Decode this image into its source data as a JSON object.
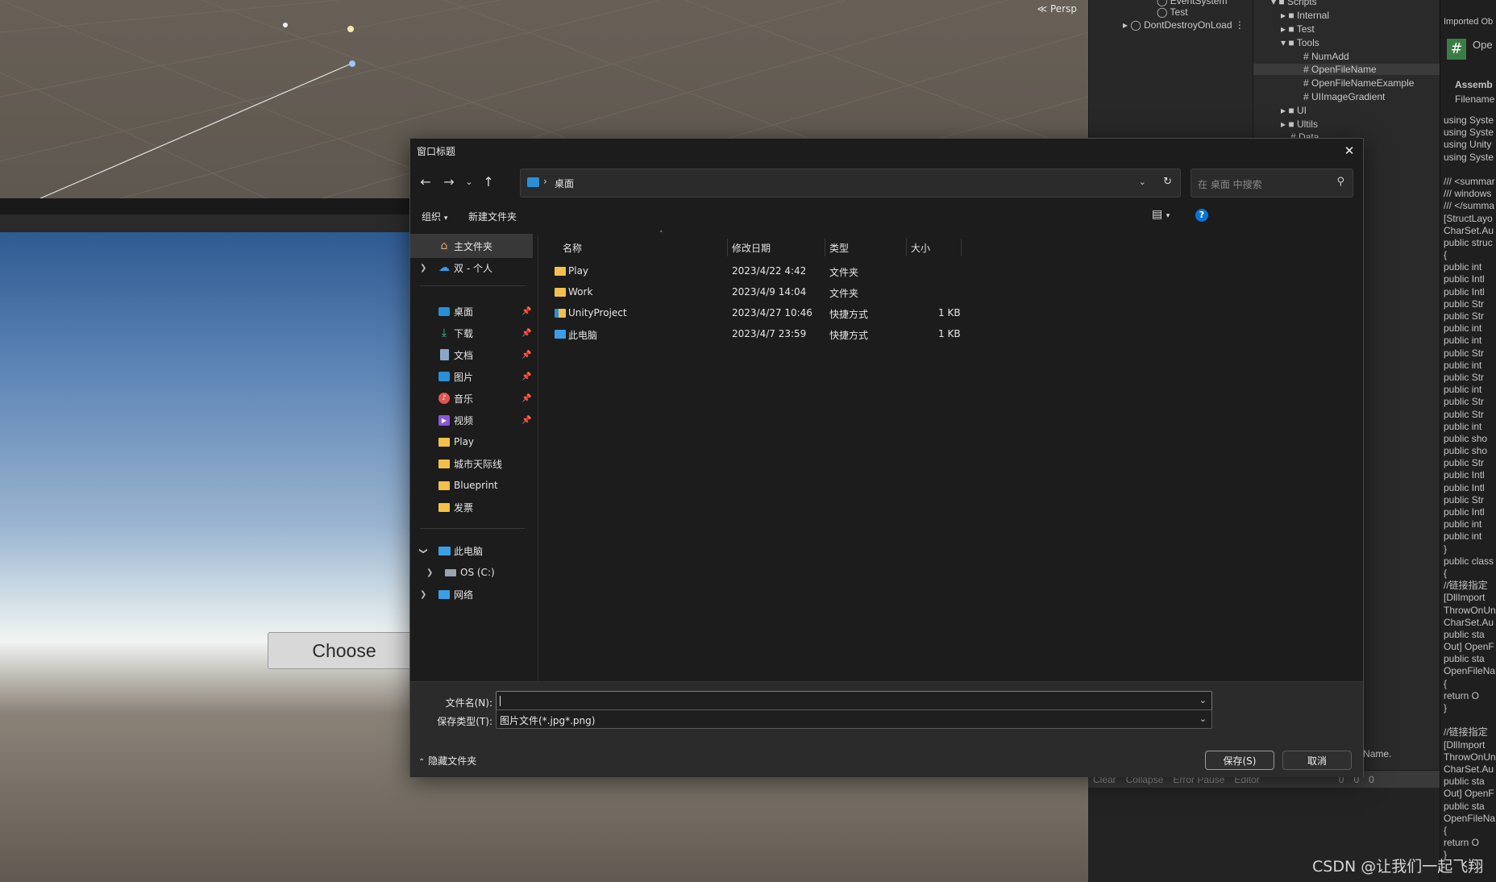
{
  "unity": {
    "scene_view_mode": "Persp",
    "game_button_label": "Choose",
    "hierarchy_items": [
      "EventSystem",
      "Test",
      "DontDestroyOnLoad"
    ],
    "project_items": [
      {
        "label": "Scripts",
        "type": "folder"
      },
      {
        "label": "Internal",
        "type": "folder"
      },
      {
        "label": "Test",
        "type": "folder"
      },
      {
        "label": "Tools",
        "type": "folder"
      },
      {
        "label": "NumAdd",
        "type": "script"
      },
      {
        "label": "OpenFileName",
        "type": "script"
      },
      {
        "label": "OpenFileNameExample",
        "type": "script"
      },
      {
        "label": "UIImageGradient",
        "type": "script"
      },
      {
        "label": "UI",
        "type": "folder"
      },
      {
        "label": "Ultils",
        "type": "folder"
      },
      {
        "label": "Data",
        "type": "script"
      }
    ],
    "console_bar": [
      "Clear",
      "Collapse",
      "Error Pause",
      "Editor"
    ],
    "console_counts": [
      "0",
      "0",
      "0"
    ],
    "console_path": "/OpenFileName.",
    "inspector": {
      "header": "Imported Ob",
      "title": "Ope",
      "assembly": "Assemb",
      "filename": "Filename",
      "code_lines": [
        "using Syste",
        "using Syste",
        "using Unity",
        "using Syste",
        "",
        "/// <summar",
        "/// windows",
        "/// </summa",
        "[StructLayo",
        "CharSet.Au",
        "public struc",
        "{",
        "  public int",
        "  public Intl",
        "  public Intl",
        "  public Str",
        "  public Str",
        "  public int",
        "  public int",
        "  public Str",
        "  public int",
        "  public Str",
        "  public int",
        "  public Str",
        "  public Str",
        "  public int",
        "  public sho",
        "  public sho",
        "  public Str",
        "  public Intl",
        "  public Intl",
        "  public Str",
        "  public Intl",
        "  public int",
        "  public int",
        "}",
        "public class",
        "{",
        "  //链接指定",
        "  [DllImport",
        "ThrowOnUn",
        "CharSet.Au",
        "  public sta",
        "Out] OpenF",
        "  public sta",
        "OpenFileNa",
        "  {",
        "    return O",
        "  }",
        "",
        "  //链接指定",
        "  [DllImport",
        "ThrowOnUn",
        "CharSet.Au",
        "  public sta",
        "Out] OpenF",
        "  public sta",
        "OpenFileNa",
        "  {",
        "    return O",
        "  }"
      ]
    },
    "watermark": "CSDN @让我们一起飞翔"
  },
  "dialog": {
    "title": "窗口标题",
    "address": {
      "location": "桌面"
    },
    "search": {
      "placeholder": "在 桌面 中搜索"
    },
    "toolbar": {
      "organize": "组织",
      "new_folder": "新建文件夹"
    },
    "nav_pane": {
      "home": "主文件夹",
      "onedrive": "双 - 个人",
      "quick_access": [
        {
          "label": "桌面",
          "icon": "desktop-icon",
          "pinned": true
        },
        {
          "label": "下载",
          "icon": "download-icon",
          "pinned": true
        },
        {
          "label": "文档",
          "icon": "document-icon",
          "pinned": true
        },
        {
          "label": "图片",
          "icon": "pictures-icon",
          "pinned": true
        },
        {
          "label": "音乐",
          "icon": "music-icon",
          "pinned": true
        },
        {
          "label": "视频",
          "icon": "video-icon",
          "pinned": true
        },
        {
          "label": "Play",
          "icon": "folder-icon",
          "pinned": false
        },
        {
          "label": "城市天际线",
          "icon": "folder-icon",
          "pinned": false
        },
        {
          "label": "Blueprint",
          "icon": "folder-icon",
          "pinned": false
        },
        {
          "label": "发票",
          "icon": "folder-icon",
          "pinned": false
        }
      ],
      "this_pc": "此电脑",
      "drive": "OS (C:)",
      "network": "网络"
    },
    "columns": [
      "名称",
      "修改日期",
      "类型",
      "大小"
    ],
    "files": [
      {
        "name": "Play",
        "date": "2023/4/22 4:42",
        "type": "文件夹",
        "size": "",
        "icon": "folder-icon"
      },
      {
        "name": "Work",
        "date": "2023/4/9 14:04",
        "type": "文件夹",
        "size": "",
        "icon": "folder-icon"
      },
      {
        "name": "UnityProject",
        "date": "2023/4/27 10:46",
        "type": "快捷方式",
        "size": "1 KB",
        "icon": "shortcut-folder-icon"
      },
      {
        "name": "此电脑",
        "date": "2023/4/7 23:59",
        "type": "快捷方式",
        "size": "1 KB",
        "icon": "shortcut-pc-icon"
      }
    ],
    "filename_label": "文件名(N):",
    "filename_value": "",
    "filetype_label": "保存类型(T):",
    "filetype_value": "图片文件(*.jpg*.png)",
    "hide_folders": "隐藏文件夹",
    "save": "保存(S)",
    "cancel": "取消",
    "colors": {
      "accent": "#0078d4",
      "folder": "#f3c14b",
      "background": "#1c1c1c",
      "footer": "#2b2b2b"
    }
  }
}
